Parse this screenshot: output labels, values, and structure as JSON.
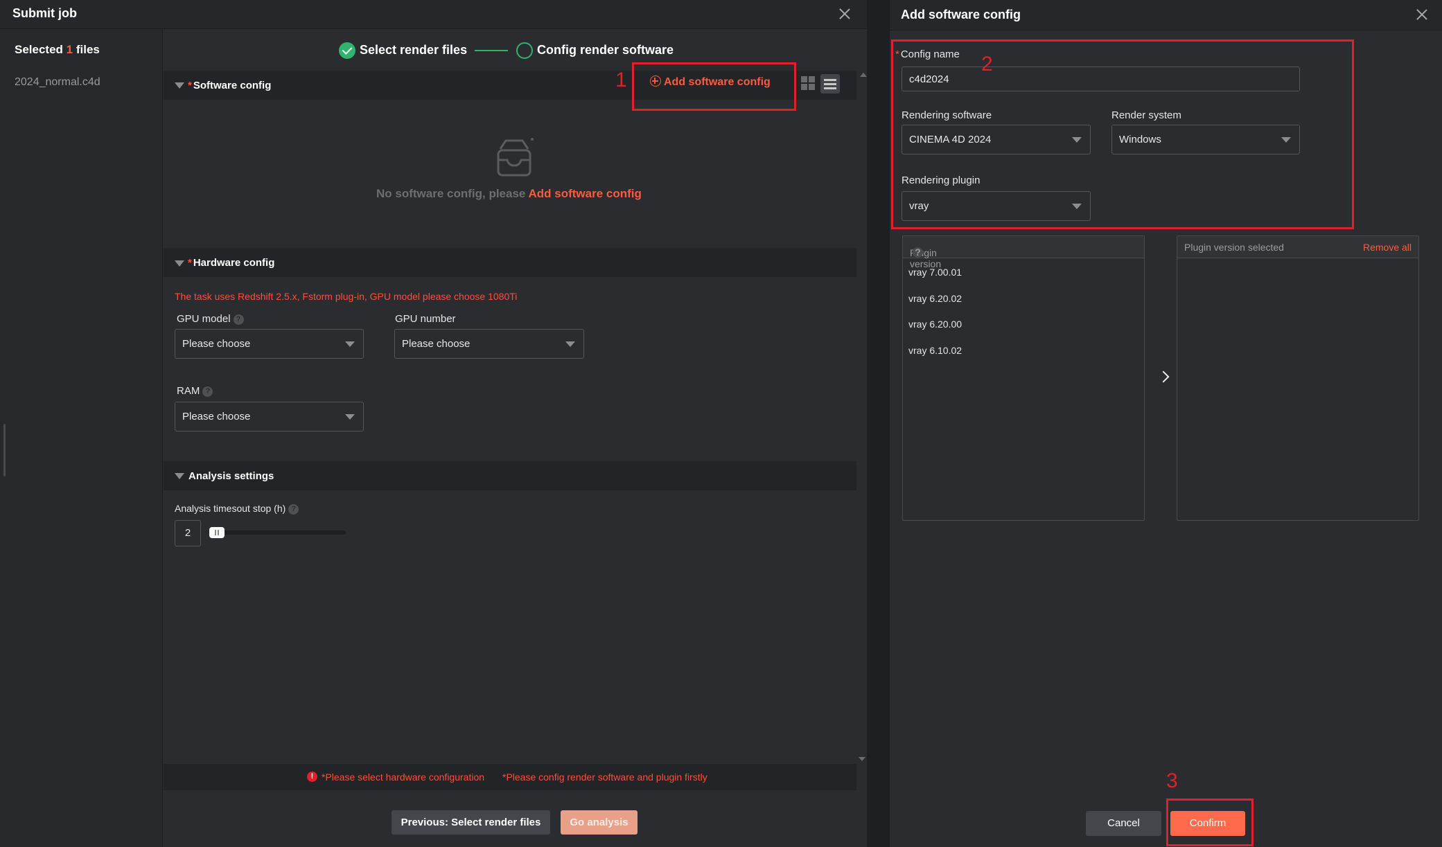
{
  "main": {
    "title": "Submit job",
    "selected": {
      "prefix": "Selected",
      "count": "1",
      "suffix": "files"
    },
    "files": [
      "2024_normal.c4d"
    ],
    "steps": [
      {
        "label": "Select render files",
        "status": "done"
      },
      {
        "label": "Config render software",
        "status": "active"
      }
    ],
    "software_config": {
      "title": "Software config",
      "add_button": "Add software config",
      "empty_text": "No software config, please",
      "empty_link": "Add software config"
    },
    "hardware_config": {
      "title": "Hardware config",
      "warning": "The task uses Redshift 2.5.x, Fstorm plug-in, GPU model please choose 1080Ti",
      "gpu_model_label": "GPU model",
      "gpu_model_value": "Please choose",
      "gpu_number_label": "GPU number",
      "gpu_number_value": "Please choose",
      "ram_label": "RAM",
      "ram_value": "Please choose"
    },
    "analysis_settings": {
      "title": "Analysis settings",
      "timeout_label": "Analysis timesout stop (h)",
      "timeout_value": "2"
    },
    "errors": {
      "hardware": "*Please select hardware configuration",
      "software": "*Please config render software and plugin firstly"
    },
    "footer": {
      "previous": "Previous: Select render files",
      "go": "Go analysis"
    }
  },
  "annotations": {
    "one": "1",
    "two": "2",
    "three": "3"
  },
  "dialog": {
    "title": "Add software config",
    "config_name_label": "Config name",
    "config_name_value": "c4d2024",
    "rendering_software_label": "Rendering software",
    "rendering_software_value": "CINEMA 4D 2024",
    "render_system_label": "Render system",
    "render_system_value": "Windows",
    "rendering_plugin_label": "Rendering plugin",
    "rendering_plugin_value": "vray",
    "plugin_version_header": "Plugin version",
    "plugin_versions": [
      "vray 7.00.01",
      "vray 6.20.02",
      "vray 6.20.00",
      "vray 6.10.02"
    ],
    "selected_header": "Plugin version selected",
    "remove_all": "Remove all",
    "cancel": "Cancel",
    "confirm": "Confirm"
  },
  "colors": {
    "accent": "#ff5a3c",
    "success": "#2fb36d",
    "annotation": "#e0202a"
  }
}
